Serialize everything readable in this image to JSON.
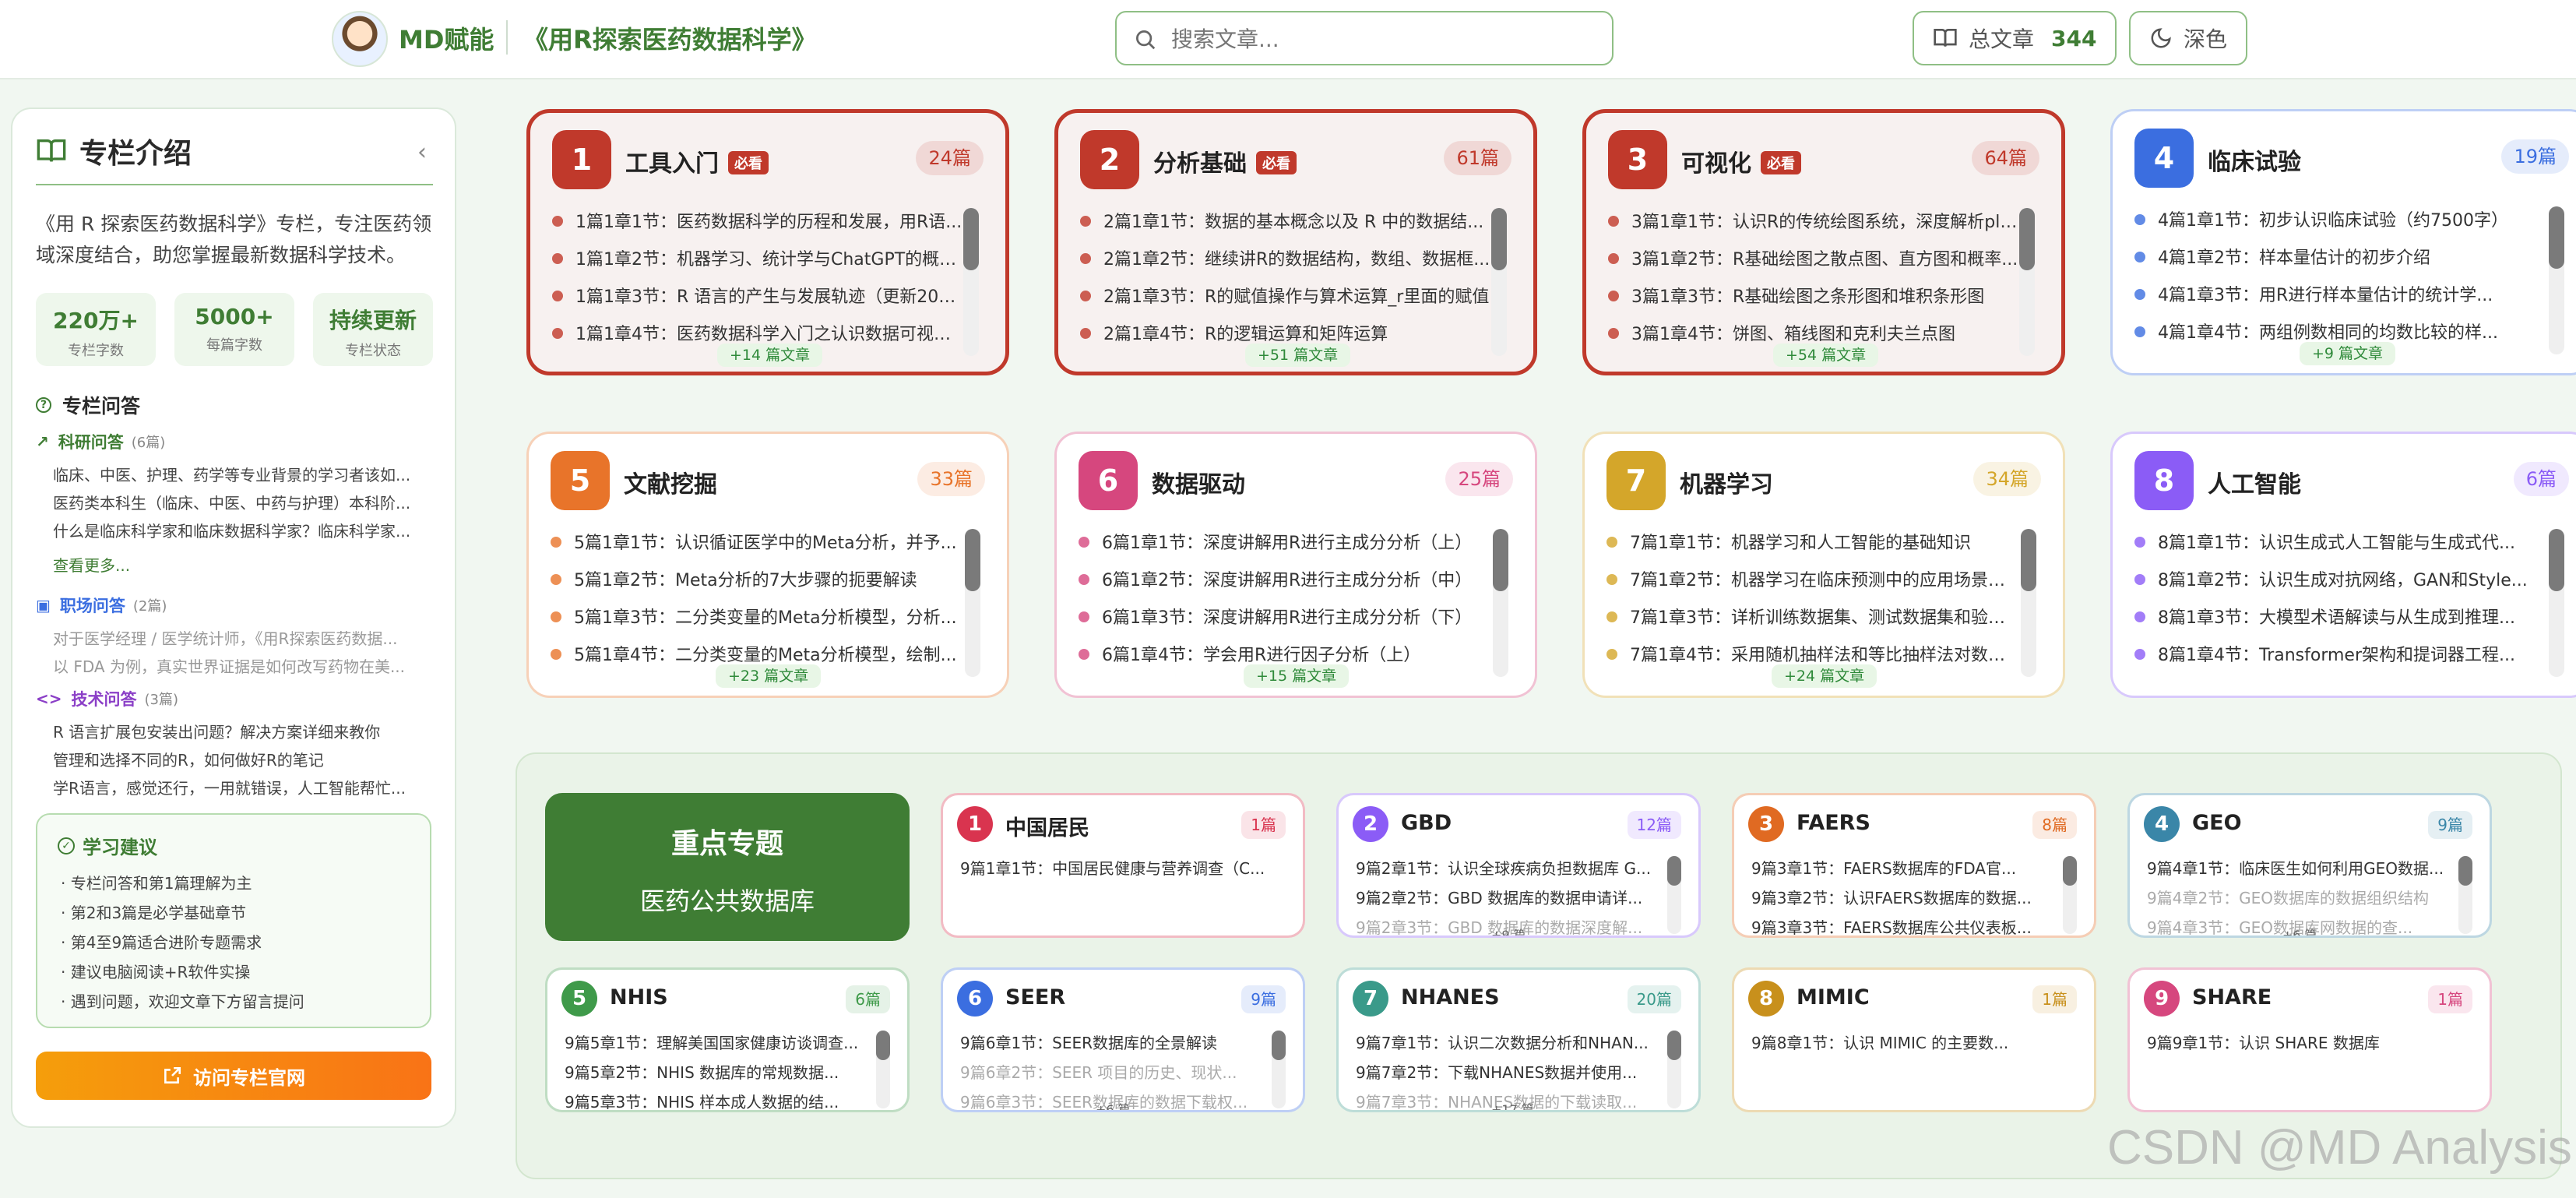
{
  "header": {
    "brand": "MD赋能",
    "book_title": "《用R探索医药数据科学》",
    "search_placeholder": "搜索文章...",
    "total_label": "总文章",
    "total_count": "344",
    "theme_label": "深色"
  },
  "sidebar": {
    "title": "专栏介绍",
    "description": "《用 R 探索医药数据科学》专栏，专注医药领域深度结合，助您掌握最新数据科学技术。",
    "stats": [
      {
        "value": "220万+",
        "label": "专栏字数"
      },
      {
        "value": "5000+",
        "label": "每篇字数"
      },
      {
        "value": "持续更新",
        "label": "专栏状态"
      }
    ],
    "qa_title": "专栏问答",
    "qa_research": {
      "label": "科研问答",
      "count": "(6篇)",
      "items": [
        "临床、中医、护理、药学等专业背景的学习者该如...",
        "医药类本科生（临床、中医、中药与护理）本科阶...",
        "什么是临床科学家和临床数据科学家？临床科学家..."
      ],
      "see_more": "查看更多..."
    },
    "qa_career": {
      "label": "职场问答",
      "count": "(2篇)",
      "items": [
        "对于医学经理 / 医学统计师，《用R探索医药数据...",
        "以 FDA 为例，真实世界证据是如何改写药物在美..."
      ]
    },
    "qa_tech": {
      "label": "技术问答",
      "count": "(3篇)",
      "items": [
        "R 语言扩展包安装出问题？解决方案详细来教你",
        "管理和选择不同的R，如何做好R的笔记",
        "学R语言，感觉还行，一用就错误，人工智能帮忙..."
      ]
    },
    "tips_title": "学习建议",
    "tips": [
      "专栏问答和第1篇理解为主",
      "第2和3篇是必学基础章节",
      "第4至9篇适合进阶专题需求",
      "建议电脑阅读+R软件实操",
      "遇到问题，欢迎文章下方留言提问"
    ],
    "visit_button": "访问专栏官网"
  },
  "chapters": [
    {
      "num": "1",
      "title": "工具入门",
      "required": "必看",
      "count": "24篇",
      "more": "+14 篇文章",
      "color": "#c0392b",
      "lines": [
        "1篇1章1节：医药数据科学的历程和发展，用R语...",
        "1篇1章2节：机器学习、统计学与ChatGPT的概述...",
        "1篇1章3节：R 语言的产生与发展轨迹（更新202...",
        "1篇1章4节：医药数据科学入门之认识数据可视化..."
      ]
    },
    {
      "num": "2",
      "title": "分析基础",
      "required": "必看",
      "count": "61篇",
      "more": "+51 篇文章",
      "color": "#c0392b",
      "lines": [
        "2篇1章1节：数据的基本概念以及 R 中的数据结...",
        "2篇1章2节：继续讲R的数据结构，数组、数据框...",
        "2篇1章3节：R的赋值操作与算术运算_r里面的赋值",
        "2篇1章4节：R的逻辑运算和矩阵运算"
      ]
    },
    {
      "num": "3",
      "title": "可视化",
      "required": "必看",
      "count": "64篇",
      "more": "+54 篇文章",
      "color": "#c0392b",
      "lines": [
        "3篇1章1节：认识R的传统绘图系统，深度解析plo...",
        "3篇1章2节：R基础绘图之散点图、直方图和概率...",
        "3篇1章3节：R基础绘图之条形图和堆积条形图",
        "3篇1章4节：饼图、箱线图和克利夫兰点图"
      ]
    },
    {
      "num": "4",
      "title": "临床试验",
      "required": "",
      "count": "19篇",
      "more": "+9 篇文章",
      "color": "#3b6ee0",
      "lines": [
        "4篇1章1节：初步认识临床试验（约7500字）",
        "4篇1章2节：样本量估计的初步介绍",
        "4篇1章3节：用R进行样本量估计的统计学...",
        "4篇1章4节：两组例数相同的均数比较的样..."
      ]
    },
    {
      "num": "5",
      "title": "文献挖掘",
      "required": "",
      "count": "33篇",
      "more": "+23 篇文章",
      "color": "#e8742a",
      "lines": [
        "5篇1章1节：认识循证医学中的Meta分析，并予...",
        "5篇1章2节：Meta分析的7大步骤的扼要解读",
        "5篇1章3节：二分类变量的Meta分析模型，分析...",
        "5篇1章4节：二分类变量的Meta分析模型，绘制..."
      ]
    },
    {
      "num": "6",
      "title": "数据驱动",
      "required": "",
      "count": "25篇",
      "more": "+15 篇文章",
      "color": "#d6477e",
      "lines": [
        "6篇1章1节：深度讲解用R进行主成分分析（上）",
        "6篇1章2节：深度讲解用R进行主成分分析（中）",
        "6篇1章3节：深度讲解用R进行主成分分析（下）",
        "6篇1章4节：学会用R进行因子分析（上）"
      ]
    },
    {
      "num": "7",
      "title": "机器学习",
      "required": "",
      "count": "34篇",
      "more": "+24 篇文章",
      "color": "#d4a62a",
      "lines": [
        "7篇1章1节：机器学习和人工智能的基础知识",
        "7篇1章2节：机器学习在临床预测中的应用场景，...",
        "7篇1章3节：详析训练数据集、测试数据集和验证...",
        "7篇1章4节：采用随机抽样法和等比抽样法对数据..."
      ]
    },
    {
      "num": "8",
      "title": "人工智能",
      "required": "",
      "count": "6篇",
      "more": "",
      "color": "#8b5cf6",
      "lines": [
        "8篇1章1节：认识生成式人工智能与生成式代...",
        "8篇1章2节：认识生成对抗网络，GAN和Style...",
        "8篇1章3节：大模型术语解读与从生成到推理...",
        "8篇1章4节：Transformer架构和提词器工程..."
      ]
    }
  ],
  "feature": {
    "line1": "重点专题",
    "line2": "医药公共数据库"
  },
  "databases": [
    {
      "num": "1",
      "title": "中国居民",
      "count": "1篇",
      "color": "#d9344f",
      "more": "",
      "lines": [
        "9篇1章1节：中国居民健康与营养调查（C..."
      ],
      "faded": []
    },
    {
      "num": "2",
      "title": "GBD",
      "count": "12篇",
      "color": "#8b5cf6",
      "more": "+9 篇",
      "lines": [
        "9篇2章1节：认识全球疾病负担数据库 G...",
        "9篇2章2节：GBD 数据库的数据申请详..."
      ],
      "faded": [
        "9篇2章3节：GBD 数据库的数据深度解..."
      ]
    },
    {
      "num": "3",
      "title": "FAERS",
      "count": "8篇",
      "color": "#e06a22",
      "more": "",
      "lines": [
        "9篇3章1节：FAERS数据库的FDA官...",
        "9篇3章2节：认识FAERS数据库的数据...",
        "9篇3章3节：FAERS数据库公共仪表板..."
      ],
      "faded": []
    },
    {
      "num": "4",
      "title": "GEO",
      "count": "9篇",
      "color": "#3a86a8",
      "more": "+6 篇",
      "lines": [
        "9篇4章1节：临床医生如何利用GEO数据..."
      ],
      "faded": [
        "9篇4章2节：GEO数据库的数据组织结构",
        "9篇4章3节：GEO数据库网数据的查..."
      ]
    },
    {
      "num": "5",
      "title": "NHIS",
      "count": "6篇",
      "color": "#3f9a4a",
      "more": "",
      "lines": [
        "9篇5章1节：理解美国国家健康访谈调查...",
        "9篇5章2节：NHIS 数据库的常规数据...",
        "9篇5章3节：NHIS 样本成人数据的结..."
      ],
      "faded": []
    },
    {
      "num": "6",
      "title": "SEER",
      "count": "9篇",
      "color": "#3b6ee0",
      "more": "+6 篇",
      "lines": [
        "9篇6章1节：SEER数据库的全景解读"
      ],
      "faded": [
        "9篇6章2节：SEER 项目的历史、现状...",
        "9篇6章3节：SEER数据库的数据下载权..."
      ]
    },
    {
      "num": "7",
      "title": "NHANES",
      "count": "20篇",
      "color": "#3a9a8a",
      "more": "+17 篇",
      "lines": [
        "9篇7章1节：认识二次数据分析和NHAN...",
        "9篇7章2节：下载NHANES数据并使用..."
      ],
      "faded": [
        "9篇7章3节：NHANES数据的下载读取..."
      ]
    },
    {
      "num": "8",
      "title": "MIMIC",
      "count": "1篇",
      "color": "#c8901c",
      "more": "",
      "lines": [
        "9篇8章1节：认识 MIMIC 的主要数..."
      ],
      "faded": []
    },
    {
      "num": "9",
      "title": "SHARE",
      "count": "1篇",
      "color": "#d6477e",
      "more": "",
      "lines": [
        "9篇9章1节：认识 SHARE 数据库"
      ],
      "faded": []
    }
  ],
  "watermark": "CSDN @MD Analysis"
}
